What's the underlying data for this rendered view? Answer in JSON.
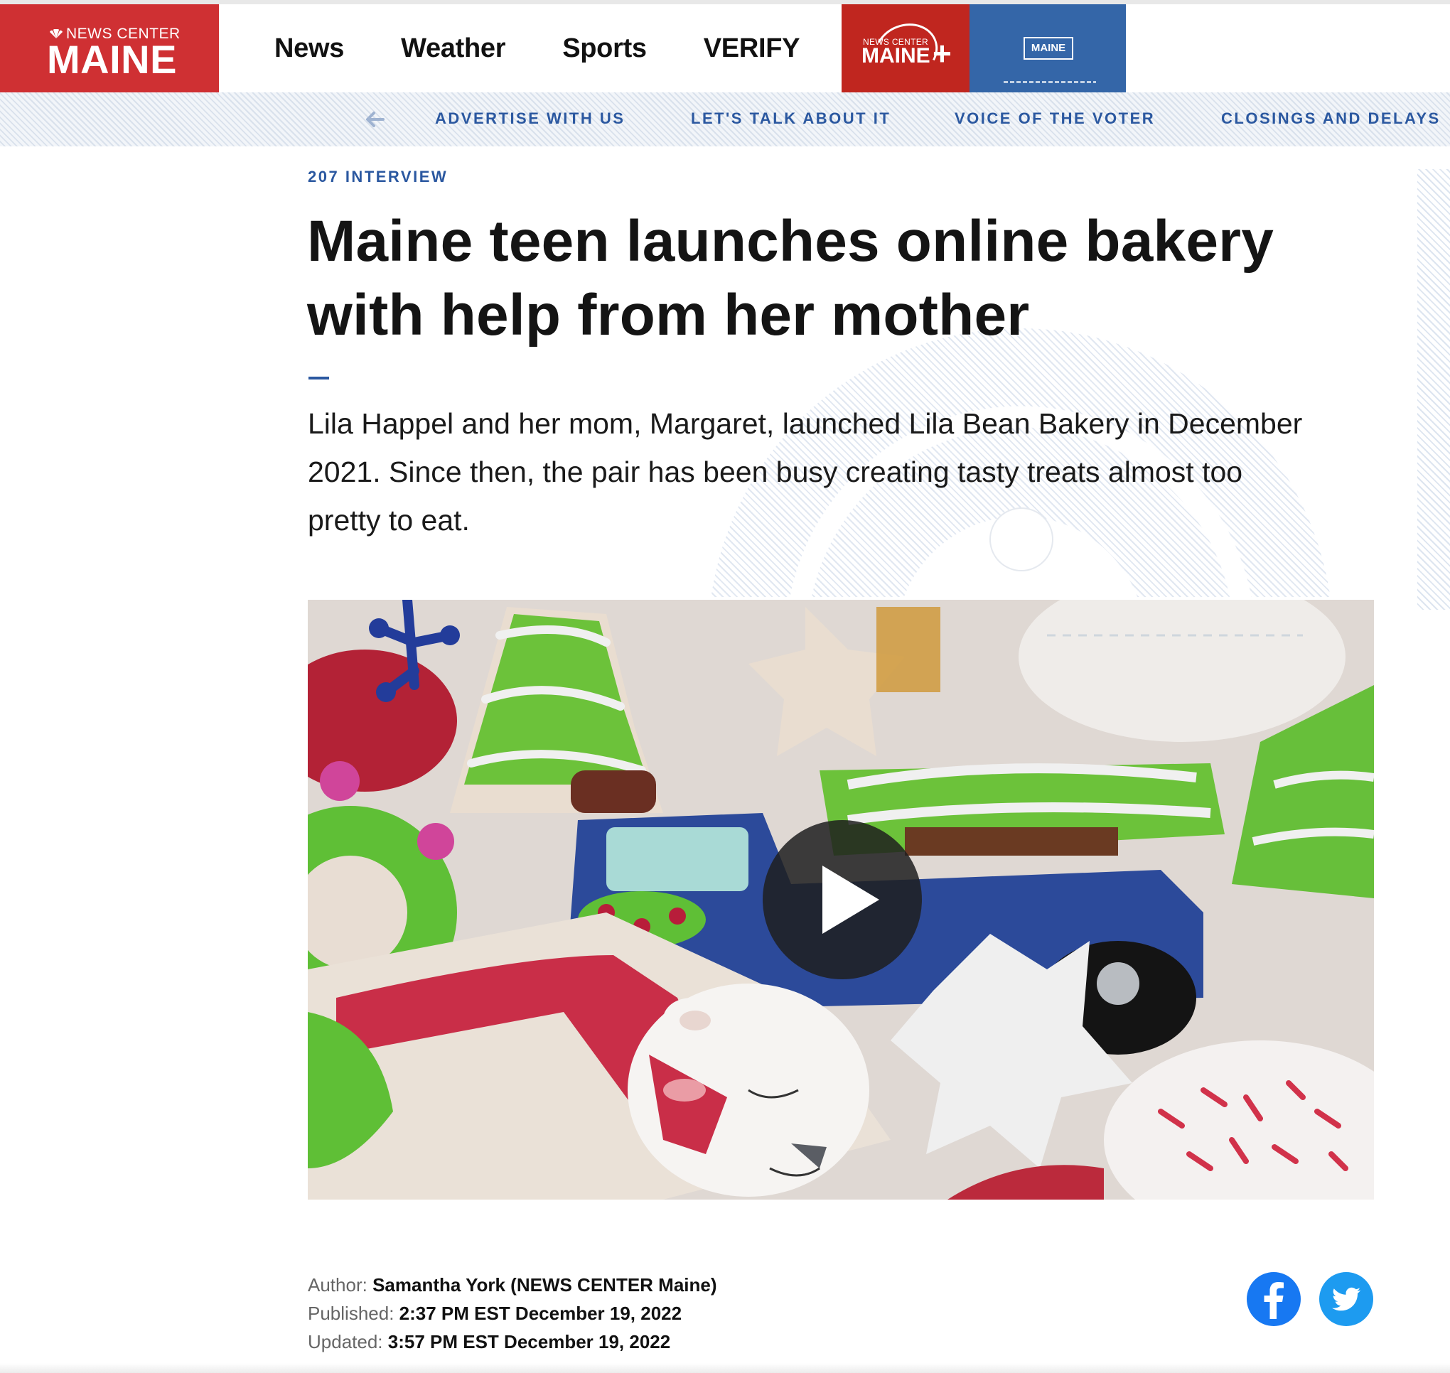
{
  "header": {
    "logo_top": "NEWS CENTER",
    "logo_main": "MAINE",
    "nav": [
      "News",
      "Weather",
      "Sports",
      "VERIFY"
    ],
    "maine_plus": {
      "small": "NEWS CENTER",
      "main": "MAINE",
      "plus": "+"
    },
    "promo_label": "MAINE"
  },
  "subnav": {
    "back_icon": "arrow-left-icon",
    "items": [
      "ADVERTISE WITH US",
      "LET'S TALK ABOUT IT",
      "VOICE OF THE VOTER",
      "CLOSINGS AND DELAYS"
    ]
  },
  "article": {
    "kicker": "207 INTERVIEW",
    "headline": "Maine teen launches online bakery with help from her mother",
    "summary": "Lila Happel and her mom, Margaret, launched Lila Bean Bakery in December 2021. Since then, the pair has been busy creating tasty treats almost too pretty to eat.",
    "video": {
      "play_icon": "play-icon",
      "subject": "decorated holiday sugar cookies"
    },
    "byline": {
      "author_label": "Author:",
      "author": "Samantha York (NEWS CENTER Maine)",
      "published_label": "Published:",
      "published": "2:37 PM EST December 19, 2022",
      "updated_label": "Updated:",
      "updated": "3:57 PM EST December 19, 2022"
    },
    "share": [
      "facebook-icon",
      "twitter-icon"
    ]
  },
  "colors": {
    "brand_red": "#cf3033",
    "maine_plus_red": "#c0261f",
    "link_blue": "#2b58a0",
    "promo_blue": "#3466a8",
    "facebook": "#1778f2",
    "twitter": "#1d9bf0"
  }
}
